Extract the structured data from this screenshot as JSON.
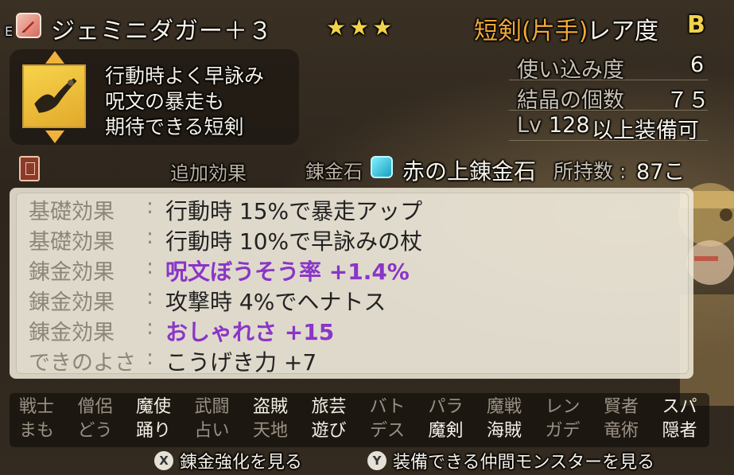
{
  "header": {
    "equip_mark": "E",
    "item_name": "ジェミニダガー＋３",
    "stars": "★★★",
    "category": "短剣(片手)",
    "rarity_label": "レア度",
    "rarity_value": "B"
  },
  "description": {
    "lines": [
      "行動時よく早詠み",
      "呪文の暴走も",
      "期待できる短剣"
    ]
  },
  "stats": {
    "usage_label": "使い込み度",
    "usage_value": "6",
    "crystal_label": "結晶の個数",
    "crystal_value": "７５",
    "level_prefix": "Lv",
    "level_value": "128",
    "level_suffix": "以上装備可"
  },
  "gem_row": {
    "tab_label": "追加効果",
    "gem_label": "錬金石",
    "gem_name": "赤の上錬金石",
    "owned_label": "所持数 :",
    "owned_value": "87こ"
  },
  "effects": [
    {
      "category": "基礎効果",
      "text": "行動時 15%で暴走アップ",
      "highlight": false
    },
    {
      "category": "基礎効果",
      "text": "行動時 10%で早詠みの杖",
      "highlight": false
    },
    {
      "category": "錬金効果",
      "text": "呪文ぼうそう率 +1.4%",
      "highlight": true
    },
    {
      "category": "錬金効果",
      "text": "攻撃時 4%でヘナトス",
      "highlight": false
    },
    {
      "category": "錬金効果",
      "text": "おしゃれさ +15",
      "highlight": true
    },
    {
      "category": "できのよさ",
      "text": "こうげき力 +7",
      "highlight": false
    }
  ],
  "jobs": [
    {
      "row": 0,
      "col": 0,
      "label": "戦士",
      "enabled": false
    },
    {
      "row": 0,
      "col": 1,
      "label": "僧侶",
      "enabled": false
    },
    {
      "row": 0,
      "col": 2,
      "label": "魔使",
      "enabled": true
    },
    {
      "row": 0,
      "col": 3,
      "label": "武闘",
      "enabled": false
    },
    {
      "row": 0,
      "col": 4,
      "label": "盗賊",
      "enabled": true
    },
    {
      "row": 0,
      "col": 5,
      "label": "旅芸",
      "enabled": true
    },
    {
      "row": 0,
      "col": 6,
      "label": "バト",
      "enabled": false
    },
    {
      "row": 0,
      "col": 7,
      "label": "パラ",
      "enabled": false
    },
    {
      "row": 0,
      "col": 8,
      "label": "魔戦",
      "enabled": false
    },
    {
      "row": 0,
      "col": 9,
      "label": "レン",
      "enabled": false
    },
    {
      "row": 0,
      "col": 10,
      "label": "賢者",
      "enabled": false
    },
    {
      "row": 0,
      "col": 11,
      "label": "スパ",
      "enabled": true
    },
    {
      "row": 1,
      "col": 0,
      "label": "まも",
      "enabled": false
    },
    {
      "row": 1,
      "col": 1,
      "label": "どう",
      "enabled": false
    },
    {
      "row": 1,
      "col": 2,
      "label": "踊り",
      "enabled": true
    },
    {
      "row": 1,
      "col": 3,
      "label": "占い",
      "enabled": false
    },
    {
      "row": 1,
      "col": 4,
      "label": "天地",
      "enabled": false
    },
    {
      "row": 1,
      "col": 5,
      "label": "遊び",
      "enabled": true
    },
    {
      "row": 1,
      "col": 6,
      "label": "デス",
      "enabled": false
    },
    {
      "row": 1,
      "col": 7,
      "label": "魔剣",
      "enabled": true
    },
    {
      "row": 1,
      "col": 8,
      "label": "海賊",
      "enabled": true
    },
    {
      "row": 1,
      "col": 9,
      "label": "ガデ",
      "enabled": false
    },
    {
      "row": 1,
      "col": 10,
      "label": "竜術",
      "enabled": false
    },
    {
      "row": 1,
      "col": 11,
      "label": "隠者",
      "enabled": true
    }
  ],
  "buttons": {
    "x_key": "X",
    "x_label": "錬金強化を見る",
    "y_key": "Y",
    "y_label": "装備できる仲間モンスターを見る"
  },
  "colors": {
    "rarity": "#f2d24a",
    "category": "#f0a83a",
    "highlight_effect": "#8a35c8",
    "job_enabled": "#f5f1e6",
    "job_disabled": "#9a9184"
  },
  "icons": {
    "weapon_type": "dagger-icon",
    "item": "gemini-dagger-icon",
    "book": "book-icon",
    "gem": "alchemy-stone-icon"
  }
}
